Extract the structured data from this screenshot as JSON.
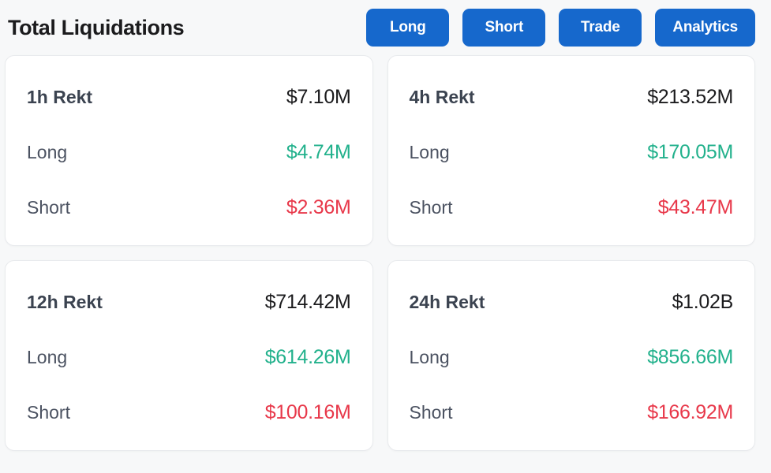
{
  "header": {
    "title": "Total Liquidations",
    "buttons": [
      {
        "label": "Long",
        "name": "long-button"
      },
      {
        "label": "Short",
        "name": "short-button"
      },
      {
        "label": "Trade",
        "name": "trade-button"
      },
      {
        "label": "Analytics",
        "name": "analytics-button"
      }
    ]
  },
  "colors": {
    "accent_blue": "#1668cc",
    "long_green": "#22b18c",
    "short_red": "#e8384a",
    "page_background": "#f7f8f9",
    "card_background": "#ffffff",
    "card_border": "#e8eaed",
    "title_text": "#1b1b1d",
    "label_text": "#4b5261"
  },
  "cards": [
    {
      "title_label": "1h Rekt",
      "title_value": "$7.10M",
      "long_label": "Long",
      "long_value": "$4.74M",
      "short_label": "Short",
      "short_value": "$2.36M"
    },
    {
      "title_label": "4h Rekt",
      "title_value": "$213.52M",
      "long_label": "Long",
      "long_value": "$170.05M",
      "short_label": "Short",
      "short_value": "$43.47M"
    },
    {
      "title_label": "12h Rekt",
      "title_value": "$714.42M",
      "long_label": "Long",
      "long_value": "$614.26M",
      "short_label": "Short",
      "short_value": "$100.16M"
    },
    {
      "title_label": "24h Rekt",
      "title_value": "$1.02B",
      "long_label": "Long",
      "long_value": "$856.66M",
      "short_label": "Short",
      "short_value": "$166.92M"
    }
  ]
}
